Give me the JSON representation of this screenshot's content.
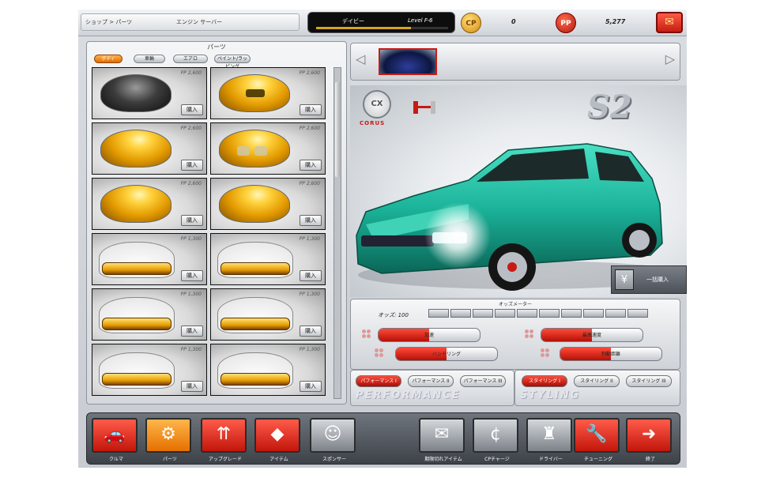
{
  "header": {
    "breadcrumb": "ショップ > パーツ",
    "current_shop": "エンジン サーバー",
    "player_name": "デイビー",
    "level": "Level F-6",
    "level_progress": 0.72,
    "cp_label": "CP",
    "cp_value": "0",
    "pp_label": "PP",
    "pp_value": "5,277",
    "mail_icon": "mail-icon"
  },
  "parts_panel": {
    "title": "パーツ",
    "tabs": [
      {
        "label": "ボディ",
        "active": true
      },
      {
        "label": "車輪",
        "active": false
      },
      {
        "label": "エアロ",
        "active": false
      },
      {
        "label": "ペイント/ラッピング",
        "active": false
      }
    ],
    "items": [
      {
        "kind": "hood-black",
        "price": "PP 2,600",
        "buy": "購入"
      },
      {
        "kind": "hood-gold-scoop",
        "price": "PP 2,600",
        "buy": "購入"
      },
      {
        "kind": "hood-gold",
        "price": "PP 2,600",
        "buy": "購入"
      },
      {
        "kind": "hood-gold-vent",
        "price": "PP 2,600",
        "buy": "購入"
      },
      {
        "kind": "hood-gold",
        "price": "PP 2,600",
        "buy": "購入"
      },
      {
        "kind": "hood-gold",
        "price": "PP 2,600",
        "buy": "購入"
      },
      {
        "kind": "bumper",
        "price": "PP 1,300",
        "buy": "購入"
      },
      {
        "kind": "bumper",
        "price": "PP 1,300",
        "buy": "購入"
      },
      {
        "kind": "bumper",
        "price": "PP 1,300",
        "buy": "購入"
      },
      {
        "kind": "bumper",
        "price": "PP 1,300",
        "buy": "購入"
      },
      {
        "kind": "bumper",
        "price": "PP 1,300",
        "buy": "購入"
      },
      {
        "kind": "bumper",
        "price": "PP 1,300",
        "buy": "購入"
      }
    ]
  },
  "car_display": {
    "maker_badge": "CX",
    "maker": "CORUS",
    "car_name": "S2",
    "bulk_buy": "一括購入",
    "bulk_icon": "yen-icon",
    "car_color": "#1bb39a"
  },
  "stats": {
    "title": "オッズメーター",
    "odds_label": "オッズ: 100",
    "bars": [
      {
        "label": "加速",
        "value": 0.5
      },
      {
        "label": "最高速度",
        "value": 0.5
      },
      {
        "label": "ハンドリング",
        "value": 0.5
      },
      {
        "label": "制動距離",
        "value": 0.5
      }
    ]
  },
  "performance": {
    "buttons": [
      "パフォーマンス I",
      "パフォーマンス II",
      "パフォーマンス III"
    ],
    "watermark": "PERFORMANCE"
  },
  "styling": {
    "buttons": [
      "スタイリング I",
      "スタイリング II",
      "スタイリング III"
    ],
    "watermark": "STYLING"
  },
  "nav": [
    {
      "label": "クルマ",
      "icon": "car-icon",
      "color": "red"
    },
    {
      "label": "パーツ",
      "icon": "parts-icon",
      "color": "org"
    },
    {
      "label": "アップグレード",
      "icon": "upgrade-icon",
      "color": "red"
    },
    {
      "label": "アイテム",
      "icon": "item-icon",
      "color": "red"
    },
    {
      "label": "スポンサー",
      "icon": "sponsor-icon",
      "color": "gry"
    },
    {
      "label": "期限切れアイテム",
      "icon": "expired-item-icon",
      "color": "gry"
    },
    {
      "label": "CPチャージ",
      "icon": "cp-charge-icon",
      "color": "gry"
    },
    {
      "label": "ドライバー",
      "icon": "driver-icon",
      "color": "gry"
    },
    {
      "label": "チューニング",
      "icon": "tuning-icon",
      "color": "red"
    },
    {
      "label": "終了",
      "icon": "exit-icon",
      "color": "red"
    }
  ]
}
